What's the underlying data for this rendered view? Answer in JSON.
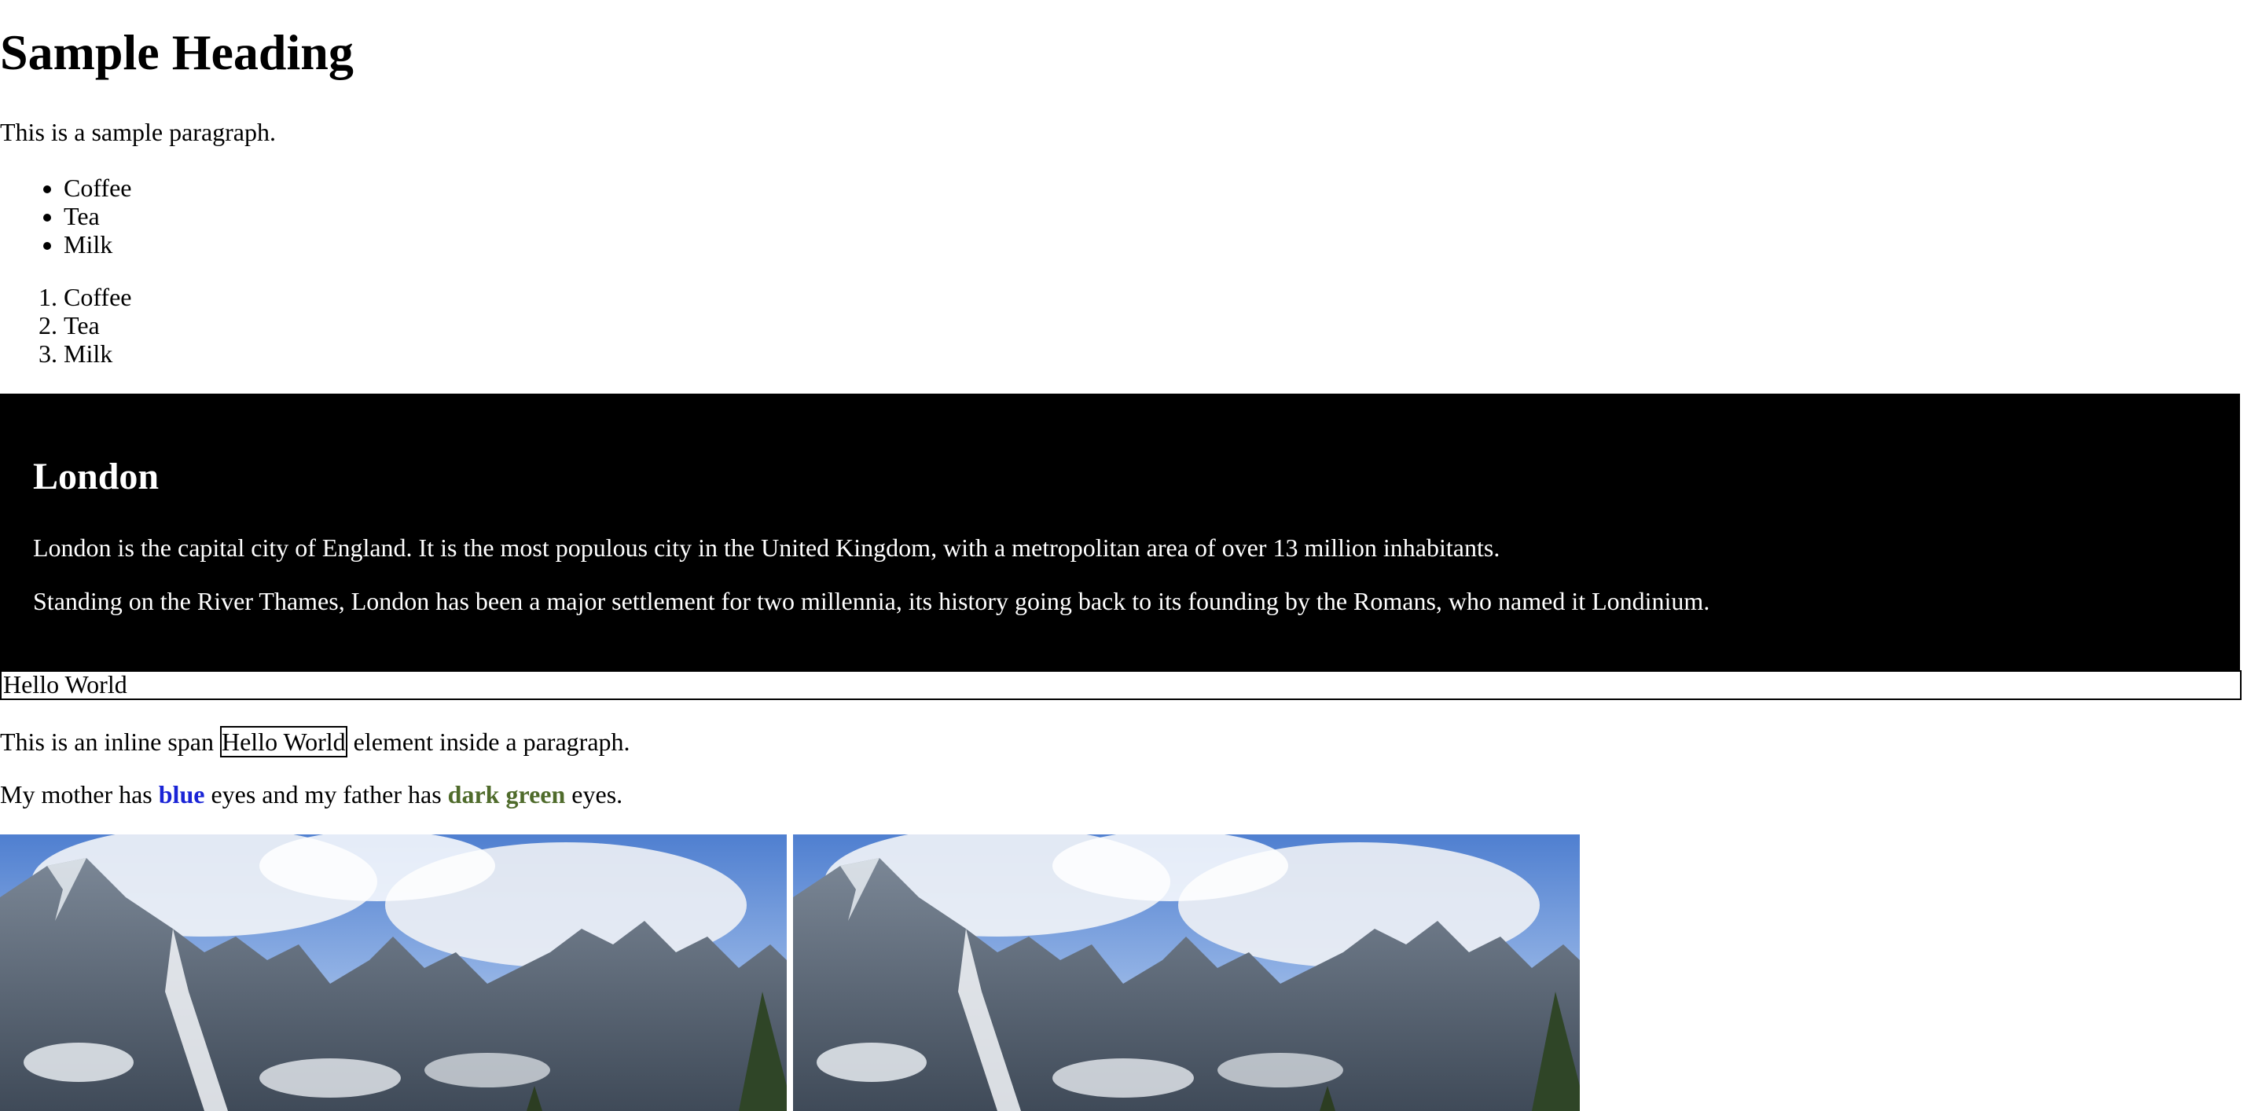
{
  "heading": "Sample Heading",
  "paragraph": "This is a sample paragraph.",
  "unordered_list": [
    "Coffee",
    "Tea",
    "Milk"
  ],
  "ordered_list": [
    "Coffee",
    "Tea",
    "Milk"
  ],
  "city": {
    "title": "London",
    "p1": "London is the capital city of England. It is the most populous city in the United Kingdom, with a metropolitan area of over 13 million inhabitants.",
    "p2": "Standing on the River Thames, London has been a major settlement for two millennia, its history going back to its founding by the Romans, who named it Londinium."
  },
  "hello_block": "Hello World",
  "inline": {
    "before": "This is an inline span ",
    "span": "Hello World",
    "after": " element inside a paragraph."
  },
  "eyes": {
    "part1": "My mother has ",
    "blue": "blue",
    "part2": " eyes and my father has ",
    "green": "dark green",
    "part3": " eyes.",
    "blue_color": "#1a24d6",
    "green_color": "#4f6b2b"
  },
  "images": [
    {
      "icon": "mountain-landscape-photo"
    },
    {
      "icon": "mountain-landscape-photo"
    }
  ]
}
